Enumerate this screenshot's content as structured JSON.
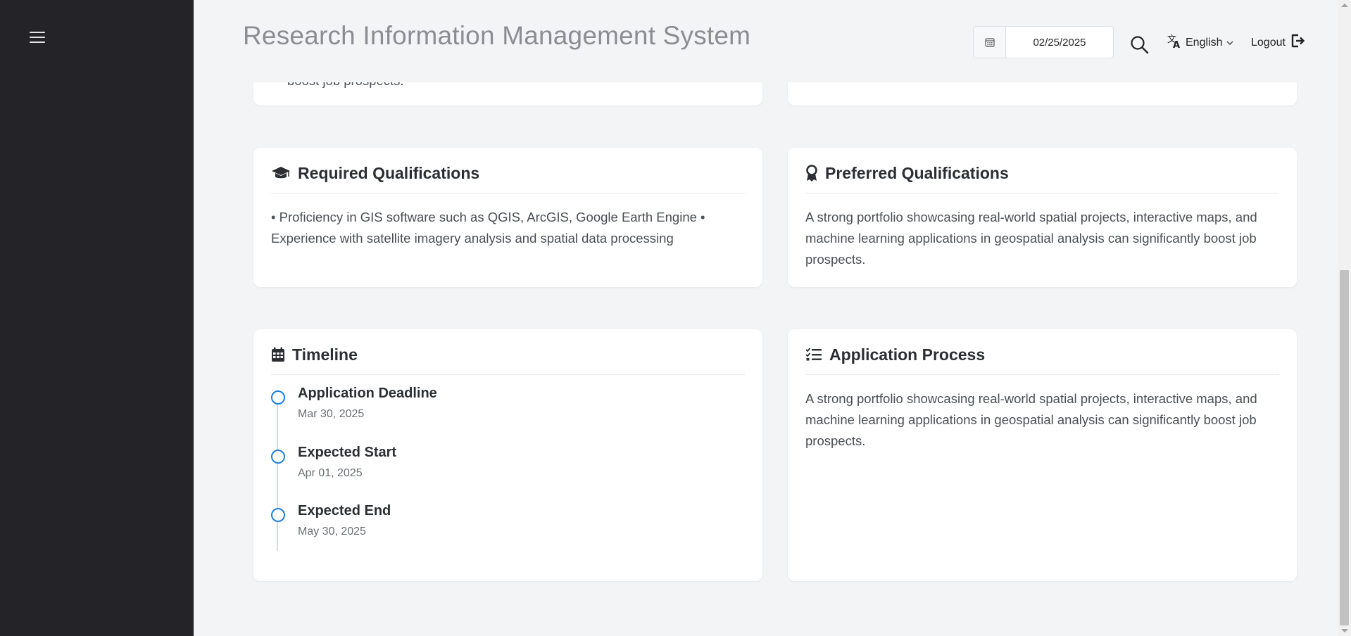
{
  "app": {
    "title": "Research Information Management System"
  },
  "header": {
    "date_value": "02/25/2025",
    "language": "English",
    "logout_label": "Logout"
  },
  "cards": {
    "top_left_partial_text": "boost job prospects.",
    "required": {
      "title": "Required Qualifications",
      "body": "• Proficiency in GIS software such as QGIS, ArcGIS, Google Earth Engine • Experience with satellite imagery analysis and spatial data processing"
    },
    "preferred": {
      "title": "Preferred Qualifications",
      "body": "A strong portfolio showcasing real-world spatial projects, interactive maps, and machine learning applications in geospatial analysis can significantly boost job prospects."
    },
    "timeline": {
      "title": "Timeline",
      "items": [
        {
          "title": "Application Deadline",
          "date": "Mar 30, 2025"
        },
        {
          "title": "Expected Start",
          "date": "Apr 01, 2025"
        },
        {
          "title": "Expected End",
          "date": "May 30, 2025"
        }
      ]
    },
    "application": {
      "title": "Application Process",
      "body": "A strong portfolio showcasing real-world spatial projects, interactive maps, and machine learning applications in geospatial analysis can significantly boost job prospects."
    }
  },
  "colors": {
    "sidebar_bg": "#242428",
    "page_bg": "#f3f4f6",
    "accent": "#1e7fe0"
  },
  "icons": {
    "menu": "hamburger-icon",
    "date": "calendar-icon",
    "search": "search-icon",
    "language": "translate-icon",
    "logout": "logout-icon",
    "required": "graduation-cap-icon",
    "preferred": "award-icon",
    "timeline": "calendar-icon",
    "application": "checklist-icon"
  }
}
